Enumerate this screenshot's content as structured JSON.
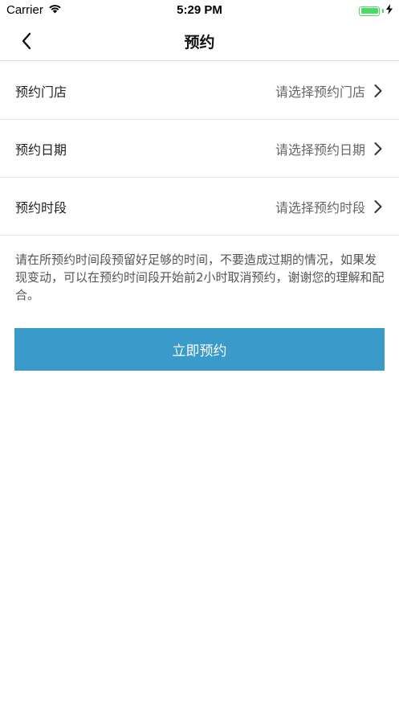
{
  "status_bar": {
    "carrier": "Carrier",
    "time": "5:29 PM",
    "battery_level": 1.0
  },
  "nav": {
    "title": "预约",
    "back_icon": "chevron-left-icon"
  },
  "rows": [
    {
      "label": "预约门店",
      "placeholder": "请选择预约门店"
    },
    {
      "label": "预约日期",
      "placeholder": "请选择预约日期"
    },
    {
      "label": "预约时段",
      "placeholder": "请选择预约时段"
    }
  ],
  "notice": "请在所预约时间段预留好足够的时间，不要造成过期的情况，如果发现变动，可以在预约时间段开始前2小时取消预约，谢谢您的理解和配合。",
  "submit_label": "立即预约",
  "colors": {
    "primary": "#3a9bcb",
    "battery": "#4cd964",
    "label": "#222222",
    "placeholder": "#666666"
  }
}
